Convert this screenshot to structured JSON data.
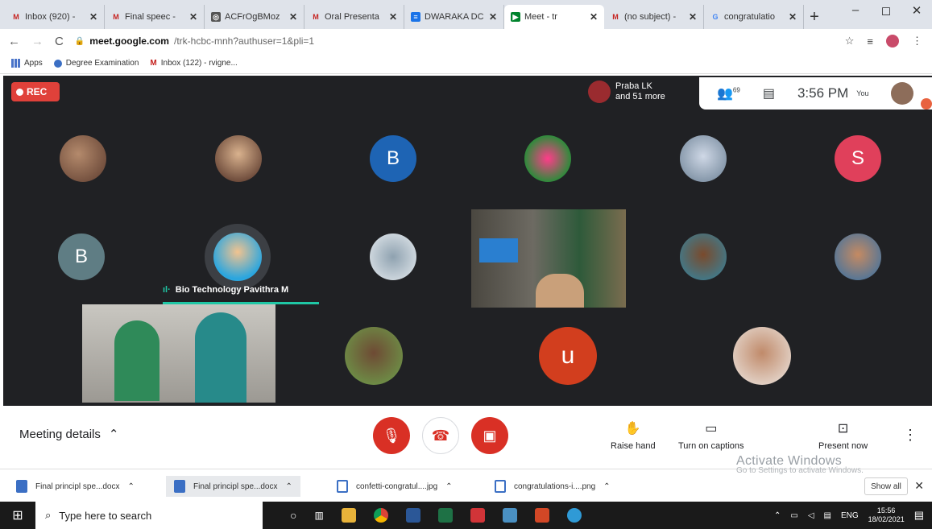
{
  "tabs": [
    {
      "title": "Inbox (920) - ",
      "icon": "gmail-icon",
      "color": "#c5221f"
    },
    {
      "title": "Final speec - ",
      "icon": "gmail-icon",
      "color": "#c5221f"
    },
    {
      "title": "ACFrOgBMoz",
      "icon": "globe-icon",
      "color": "#555555"
    },
    {
      "title": "Oral Presenta",
      "icon": "gmail-icon",
      "color": "#c5221f"
    },
    {
      "title": "DWARAKA DC",
      "icon": "docs-icon",
      "color": "#1a73e8"
    },
    {
      "title": "Meet - tr",
      "icon": "meet-icon",
      "color": "#00832d"
    },
    {
      "title": "(no subject) - ",
      "icon": "gmail-icon",
      "color": "#c5221f"
    },
    {
      "title": "congratulatio",
      "icon": "google-icon",
      "color": "#4285f4"
    }
  ],
  "address": {
    "host": "meet.google.com",
    "path": "/trk-hcbc-mnh?authuser=1&pli=1"
  },
  "bookmarks": [
    "Apps",
    "Degree Examination",
    "Inbox (122) - rvigne..."
  ],
  "meet": {
    "rec": "REC",
    "joined_name": "Praba LK",
    "joined_more": "and 51 more",
    "participants_count": "69",
    "time": "3:56 PM",
    "you": "You",
    "speaker_name": "Bio Technology Pavithra M",
    "letters": [
      "B",
      "S",
      "B",
      "u"
    ],
    "accent": "#1fc7a5",
    "rec_color": "#e0413a"
  },
  "controls": {
    "meeting_details": "Meeting details",
    "raise_hand": "Raise hand",
    "captions": "Turn on captions",
    "present": "Present now",
    "watermark_title": "Activate Windows",
    "watermark_sub": "Go to Settings to activate Windows.",
    "end_color": "#d93025"
  },
  "downloads": {
    "items": [
      "Final principl spe...docx",
      "Final principl spe...docx",
      "confetti-congratul....jpg",
      "congratulations-i....png"
    ],
    "show_all": "Show all"
  },
  "taskbar": {
    "search": "Type here to search",
    "lang": "ENG",
    "time": "15:56",
    "date": "18/02/2021"
  }
}
